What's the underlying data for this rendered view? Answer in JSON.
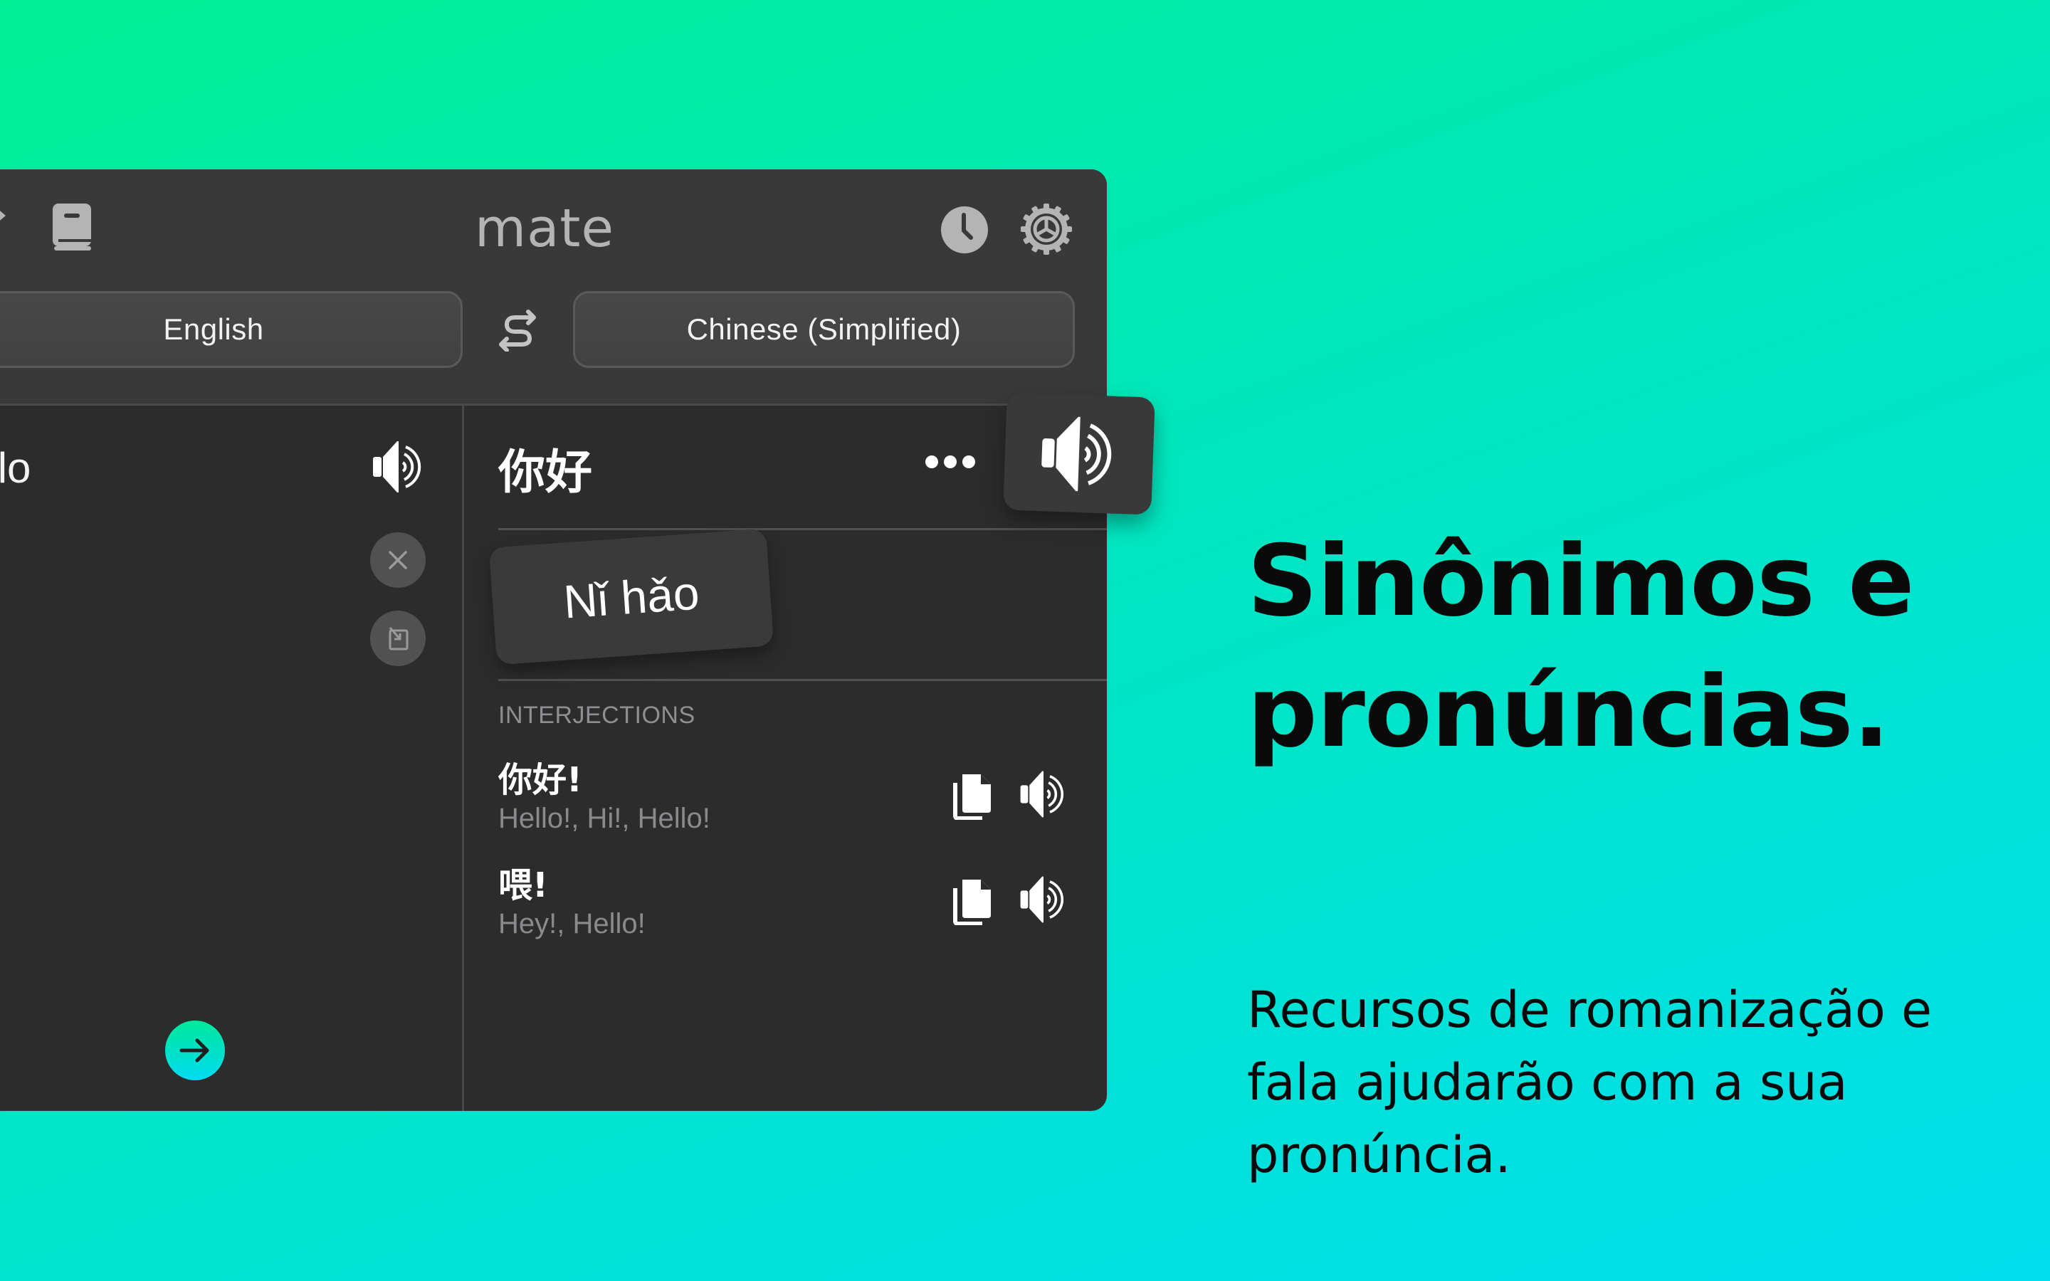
{
  "app": {
    "title": "mate"
  },
  "toolbar": {
    "icons": [
      "arrow-icon",
      "book-icon",
      "history-icon",
      "settings-icon"
    ]
  },
  "languages": {
    "source": "English",
    "target": "Chinese (Simplified)",
    "swap_icon": "swap-arrows-icon"
  },
  "source_pane": {
    "text": "ello",
    "actions": [
      "speaker-icon",
      "clear-icon",
      "paste-icon"
    ],
    "translate_button_icon": "arrow-right-icon"
  },
  "target_pane": {
    "translation": "你好",
    "romanization": "Nǐ hǎo",
    "more_icon": "more-dots-icon",
    "section_label": "INTERJECTIONS",
    "entries": [
      {
        "term": "你好!",
        "meanings": "Hello!, Hi!, Hello!"
      },
      {
        "term": "喂!",
        "meanings": "Hey!, Hello!"
      }
    ]
  },
  "marketing": {
    "headline_line1": "Sinônimos e",
    "headline_line2": "pronúncias.",
    "subtext": "Recursos de romanização e fala ajudarão com a sua pronúncia."
  },
  "colors": {
    "bg_top_left": "#00EF95",
    "bg_bottom_right": "#00DEEE",
    "window_bg": "#2C2C2C",
    "toolbar_bg": "#393939",
    "accent": "#00E1C8"
  }
}
